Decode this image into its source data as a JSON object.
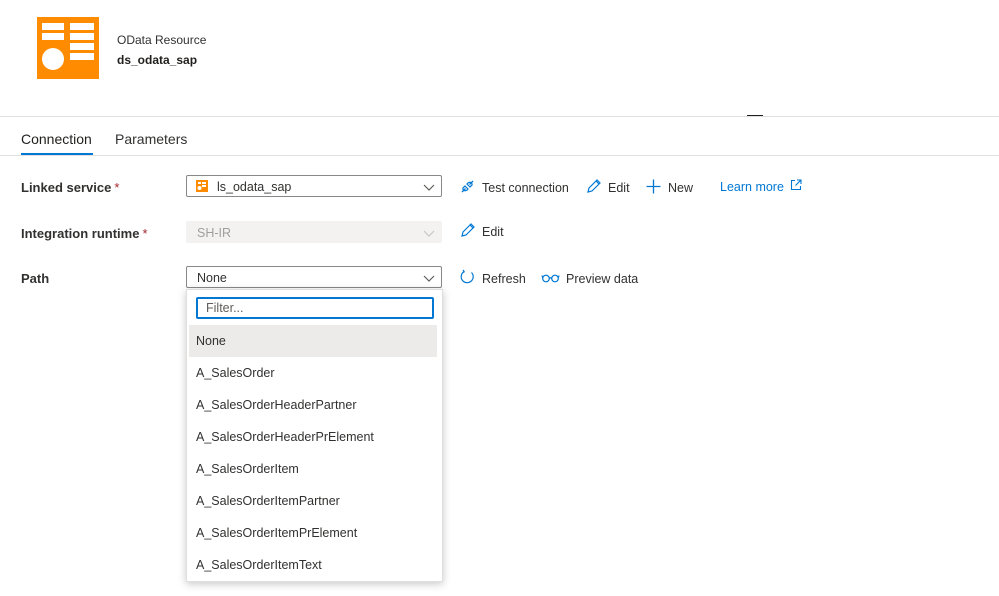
{
  "header": {
    "resource_type": "OData Resource",
    "dataset_name": "ds_odata_sap",
    "logo_color": "#FF8C00"
  },
  "tabs": [
    {
      "label": "Connection",
      "active": true
    },
    {
      "label": "Parameters",
      "active": false
    }
  ],
  "linked_service": {
    "label": "Linked service",
    "required_mark": "*",
    "value": "ls_odata_sap",
    "actions": {
      "test_connection": "Test connection",
      "edit": "Edit",
      "new": "New",
      "learn_more": "Learn more"
    }
  },
  "integration_runtime": {
    "label": "Integration runtime",
    "required_mark": "*",
    "value": "SH-IR",
    "disabled": true,
    "actions": {
      "edit": "Edit"
    }
  },
  "path": {
    "label": "Path",
    "value": "None",
    "actions": {
      "refresh": "Refresh",
      "preview": "Preview data"
    },
    "dropdown": {
      "filter_placeholder": "Filter...",
      "options": [
        "None",
        "A_SalesOrder",
        "A_SalesOrderHeaderPartner",
        "A_SalesOrderHeaderPrElement",
        "A_SalesOrderItem",
        "A_SalesOrderItemPartner",
        "A_SalesOrderItemPrElement",
        "A_SalesOrderItemText"
      ],
      "selected_index": 0
    }
  },
  "colors": {
    "accent": "#0078d4",
    "required": "#a4262c",
    "text": "#323130"
  }
}
